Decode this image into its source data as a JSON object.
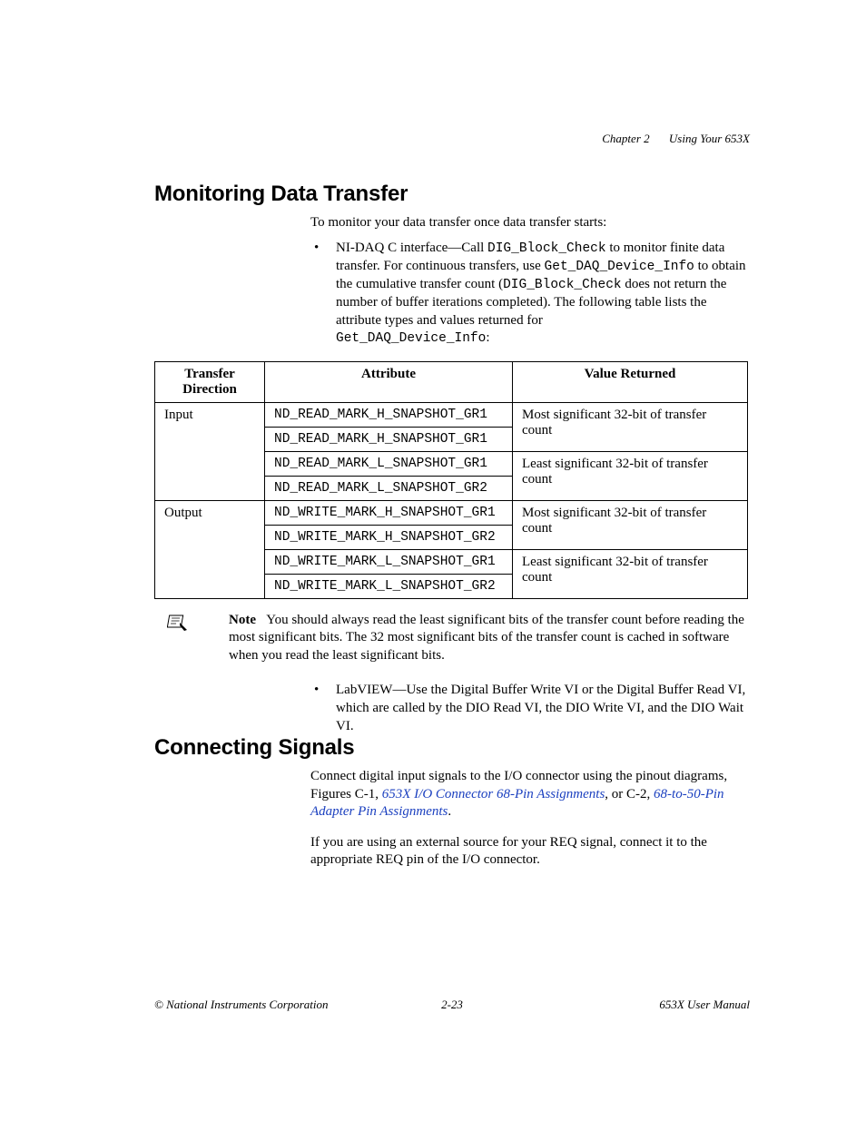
{
  "header": {
    "chapter": "Chapter 2",
    "title": "Using Your 653X"
  },
  "section1": {
    "heading": "Monitoring Data Transfer",
    "intro": "To monitor your data transfer once data transfer starts:",
    "bullet1": {
      "pre1": "NI-DAQ C interface—Call ",
      "code1": "DIG_Block_Check",
      "mid1": " to monitor finite data transfer. For continuous transfers, use ",
      "code2": "Get_DAQ_Device_Info",
      "mid2": " to obtain the cumulative transfer count (",
      "code3": "DIG_Block_Check",
      "mid3": " does not return the number of buffer iterations completed). The following table lists the attribute types and values returned for ",
      "code4": "Get_DAQ_Device_Info",
      "post": ":"
    },
    "table": {
      "headers": {
        "c1l1": "Transfer",
        "c1l2": "Direction",
        "c2": "Attribute",
        "c3": "Value Returned"
      },
      "rows": [
        {
          "dir": "Input",
          "attr": "ND_READ_MARK_H_SNAPSHOT_GR1",
          "val": "Most significant 32-bit of transfer count"
        },
        {
          "dir": "",
          "attr": "ND_READ_MARK_H_SNAPSHOT_GR1",
          "val": ""
        },
        {
          "dir": "",
          "attr": "ND_READ_MARK_L_SNAPSHOT_GR1",
          "val": "Least significant 32-bit of transfer count"
        },
        {
          "dir": "",
          "attr": "ND_READ_MARK_L_SNAPSHOT_GR2",
          "val": ""
        },
        {
          "dir": "Output",
          "attr": "ND_WRITE_MARK_H_SNAPSHOT_GR1",
          "val": "Most significant 32-bit of transfer count"
        },
        {
          "dir": "",
          "attr": "ND_WRITE_MARK_H_SNAPSHOT_GR2",
          "val": ""
        },
        {
          "dir": "",
          "attr": "ND_WRITE_MARK_L_SNAPSHOT_GR1",
          "val": "Least significant 32-bit of transfer count"
        },
        {
          "dir": "",
          "attr": "ND_WRITE_MARK_L_SNAPSHOT_GR2",
          "val": ""
        }
      ]
    },
    "note": {
      "label": "Note",
      "text": "You should always read the least significant bits of the transfer count before reading the most significant bits. The 32 most significant bits of the transfer count is cached in software when you read the least significant bits."
    },
    "bullet2": "LabVIEW—Use the Digital Buffer Write VI or the Digital Buffer Read VI, which are called by the DIO Read VI, the DIO Write VI, and the DIO Wait VI."
  },
  "section2": {
    "heading": "Connecting Signals",
    "para1": {
      "pre": "Connect digital input signals to the I/O connector using the pinout diagrams, Figures C-1, ",
      "link1": "653X I/O Connector 68-Pin Assignments",
      "mid": ", or C-2, ",
      "link2": "68-to-50-Pin Adapter Pin Assignments",
      "post": "."
    },
    "para2": "If you are using an external source for your REQ signal, connect it to the appropriate REQ pin of the I/O connector."
  },
  "footer": {
    "left": "© National Instruments Corporation",
    "center": "2-23",
    "right": "653X User Manual"
  }
}
